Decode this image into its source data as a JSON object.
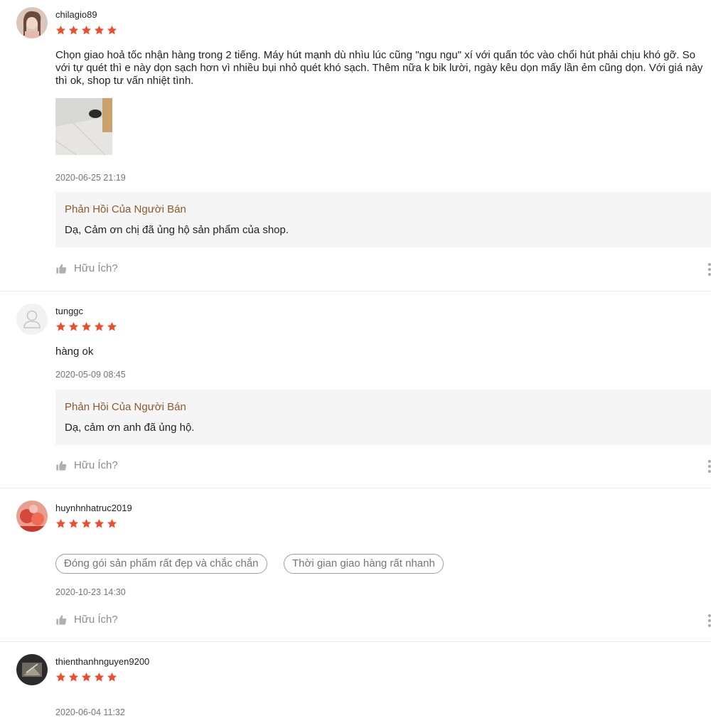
{
  "star_color": "#ee4d2d",
  "reviews": [
    {
      "username": "chilagio89",
      "rating": 5,
      "comment": "Chọn giao hoả tốc nhận hàng trong 2 tiếng. Máy hút mạnh dù nhìu lúc cũng \"ngu ngu\" xí với quấn tóc vào chổi hút phải chịu khó gỡ. So với tự quét thì e này dọn sạch hơn vì nhiều bụi nhỏ quét khó sạch. Thêm nữa k bik lười, ngày kêu dọn mấy lần ẻm cũng dọn. Với giá này thì ok, shop tư vấn nhiệt tình.",
      "date": "2020-06-25 21:19",
      "reply_title": "Phản Hồi Của Người Bán",
      "reply_text": "Dạ, Cảm ơn chị đã ủng hộ sản phẩm của shop.",
      "helpful_label": "Hữu Ích?"
    },
    {
      "username": "tunggc",
      "rating": 5,
      "comment": "hàng ok",
      "date": "2020-05-09 08:45",
      "reply_title": "Phản Hồi Của Người Bán",
      "reply_text": "Dạ, cảm ơn anh đã ủng hộ.",
      "helpful_label": "Hữu Ích?"
    },
    {
      "username": "huynhnhatruc2019",
      "rating": 5,
      "tags": [
        "Đóng gói sản phẩm rất đẹp và chắc chắn",
        "Thời gian giao hàng rất nhanh"
      ],
      "date": "2020-10-23 14:30",
      "helpful_label": "Hữu Ích?"
    },
    {
      "username": "thienthanhnguyen9200",
      "rating": 5,
      "date": "2020-06-04 11:32"
    }
  ]
}
